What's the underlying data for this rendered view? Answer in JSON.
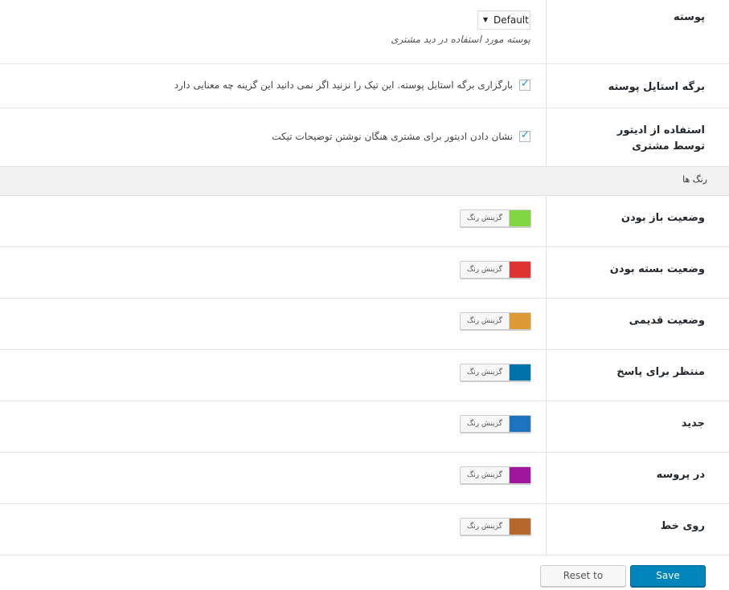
{
  "settings": {
    "skin": {
      "label": "پوسته",
      "selected": "Default",
      "description": "پوسته مورد استفاده در دید مشتری"
    },
    "skin_style": {
      "label": "برگه استایل پوسته",
      "checkbox_text": "بارگزاری برگه استایل پوسته. این تیک را نزنید اگر نمی دانید این گزینه چه معنایی دارد",
      "checked": true
    },
    "customer_editor": {
      "label": "استفاده از ادیتور توسط مشتری",
      "checkbox_text": "نشان دادن ادیتور برای مشتری هنگان نوشتن توضیحات تیکت",
      "checked": true
    }
  },
  "colors_section": {
    "title": "رنگ ها",
    "picker_label": "گزینش رنگ",
    "items": [
      {
        "label": "وضعیت باز بودن",
        "color": "#81d742"
      },
      {
        "label": "وضعیت بسته بودن",
        "color": "#dd3333"
      },
      {
        "label": "وضعیت قدیمی",
        "color": "#dd9933"
      },
      {
        "label": "منتظر برای پاسخ",
        "color": "#0073aa"
      },
      {
        "label": "جدید",
        "color": "#1e73be"
      },
      {
        "label": "در پروسه",
        "color": "#a0179d"
      },
      {
        "label": "روی خط",
        "color": "#b5682a"
      }
    ]
  },
  "footer": {
    "reset_label": "Reset to Defaults",
    "save_label": "Save Changes"
  }
}
